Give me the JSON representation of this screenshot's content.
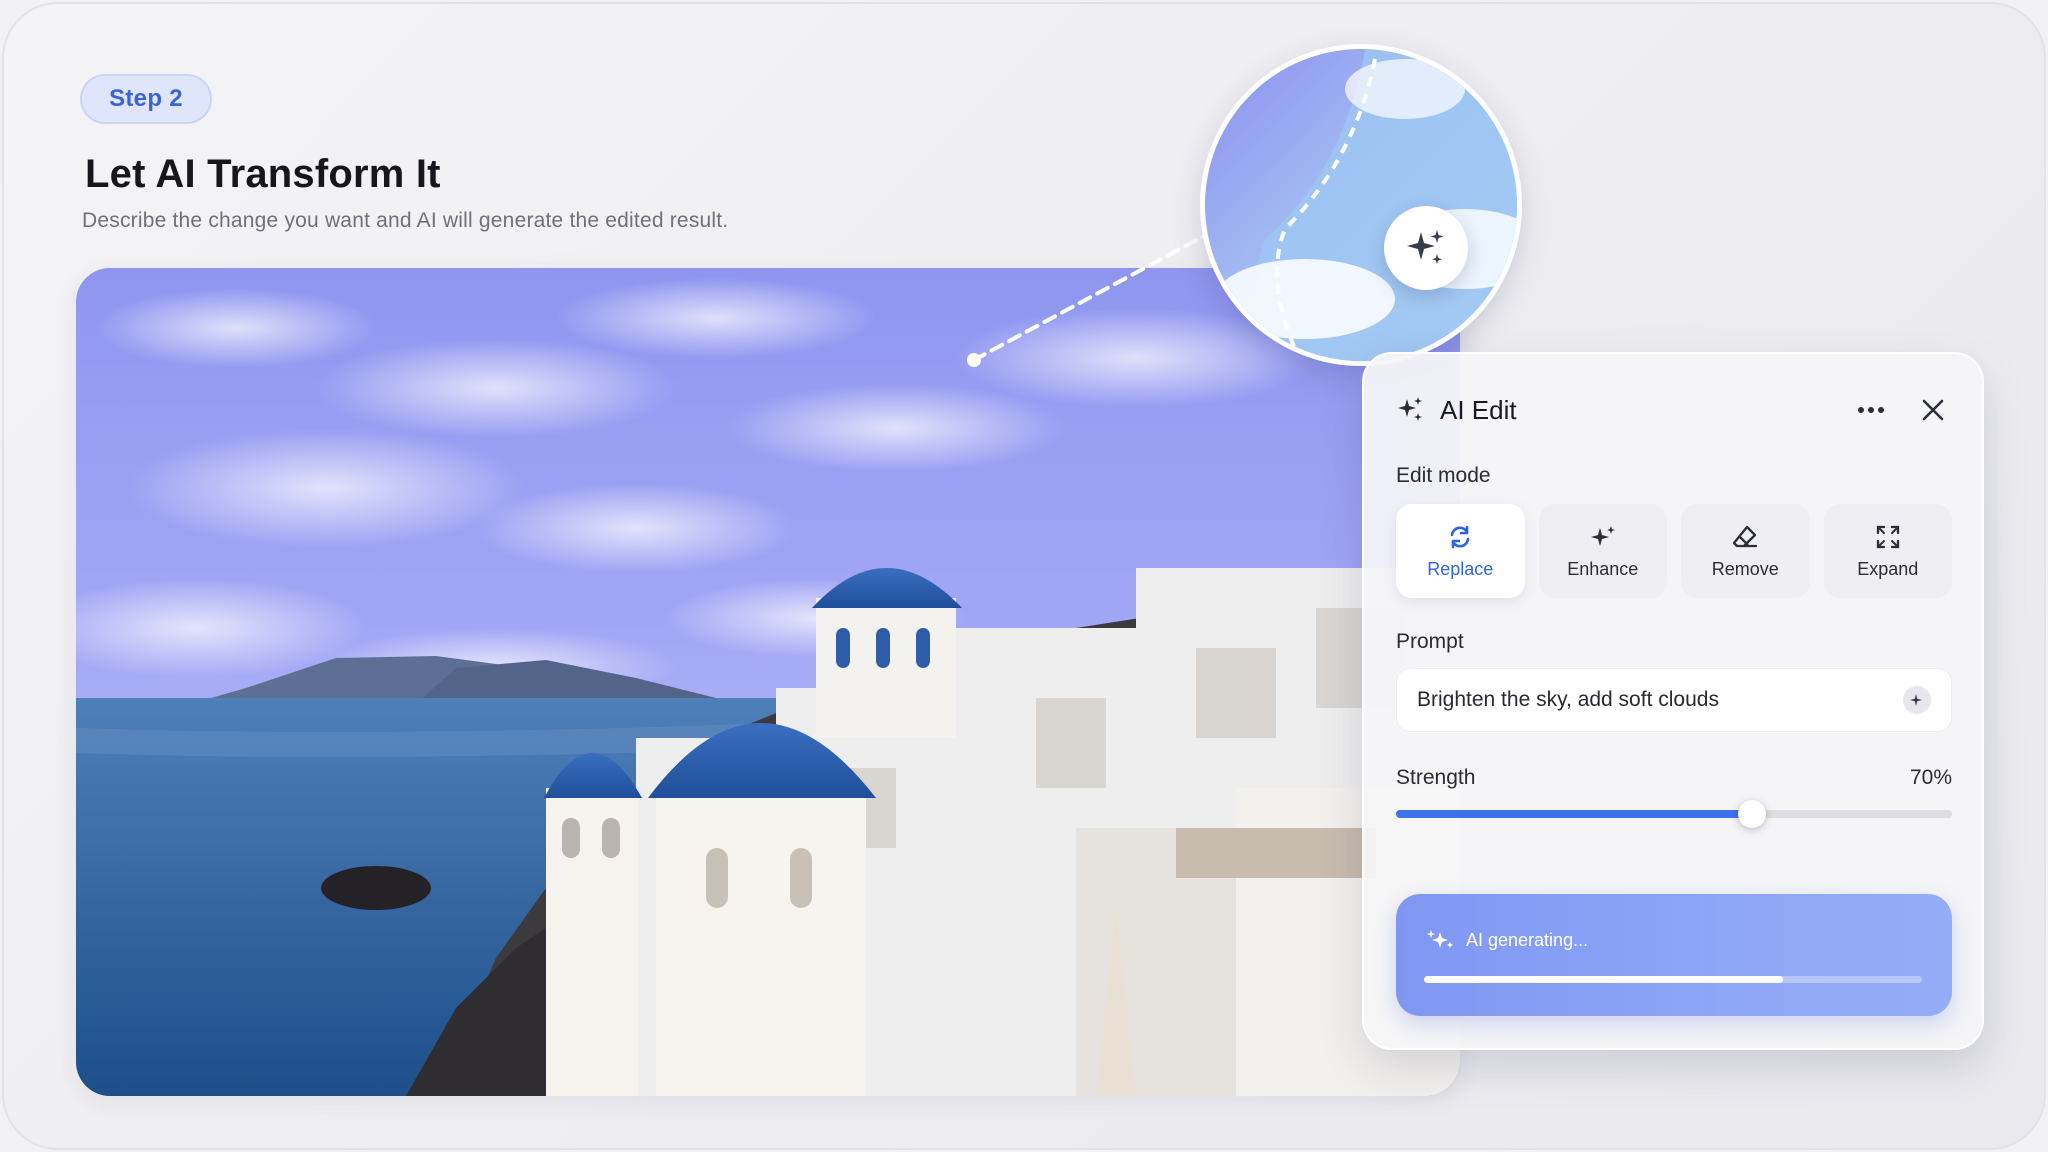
{
  "step": {
    "label": "Step 2"
  },
  "header": {
    "title": "Let AI Transform It",
    "subtitle": "Describe the change you want and AI will generate the edited result."
  },
  "photo": {
    "icon": "santorini-photo"
  },
  "magnifier": {
    "icon": "sparkle-icon"
  },
  "panel": {
    "title": "AI Edit",
    "more_icon": "more-horizontal-icon",
    "close_icon": "close-icon",
    "edit_mode_label": "Edit mode",
    "modes": [
      {
        "label": "Replace",
        "icon": "refresh-icon",
        "active": true
      },
      {
        "label": "Enhance",
        "icon": "sparkle-icon",
        "active": false
      },
      {
        "label": "Remove",
        "icon": "eraser-icon",
        "active": false
      },
      {
        "label": "Expand",
        "icon": "expand-icon",
        "active": false
      }
    ],
    "prompt_label": "Prompt",
    "prompt_value": "Brighten the sky, add soft clouds",
    "strength_label": "Strength",
    "strength_value": "70%",
    "strength_fraction": 0.64,
    "generating_label": "AI generating...",
    "generating_progress": 0.72
  },
  "colors": {
    "accent": "#3d73ea",
    "step_text": "#3b63d6",
    "generating_bg": "#8ea6f6"
  }
}
